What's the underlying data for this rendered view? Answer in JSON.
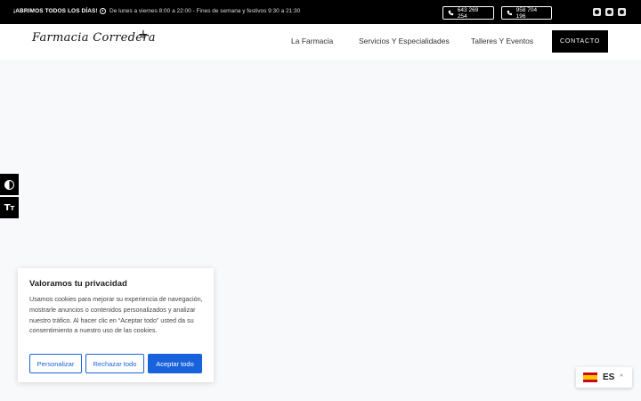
{
  "topbar": {
    "open_days": "¡ABRIMOS TODOS LOS DÍAS!",
    "hours": "De lunes a viernes 8:00 a 22:00 - Fines de semana y festivos 9:30 a 21:30",
    "phone1": "643 269 254",
    "phone2": "958 704 196",
    "social_icons": [
      "facebook-icon",
      "instagram-icon",
      "tiktok-icon"
    ]
  },
  "header": {
    "logo_text": "Farmacia Corredera",
    "logo_cross": "+",
    "nav": [
      "La Farmacia",
      "Servicios Y Especialidades",
      "Talleres Y Eventos"
    ],
    "contact_label": "CONTACTO"
  },
  "accessibility": {
    "contrast_icon": "contrast-icon",
    "text_size_icon": "text-size-icon"
  },
  "cookie_banner": {
    "title": "Valoramos tu privacidad",
    "text": "Usamos cookies para mejorar su experiencia de navegación, mostrarle anuncios o contenidos personalizados y analizar nuestro tráfico. Al hacer clic en “Aceptar todo” usted da su consentimiento a nuestro uso de las cookies.",
    "customize_label": "Personalizar",
    "reject_label": "Rechazar todo",
    "accept_label": "Aceptar todo",
    "accent_color": "#1863dc"
  },
  "language": {
    "code": "ES",
    "flag": "spain-flag-icon"
  }
}
